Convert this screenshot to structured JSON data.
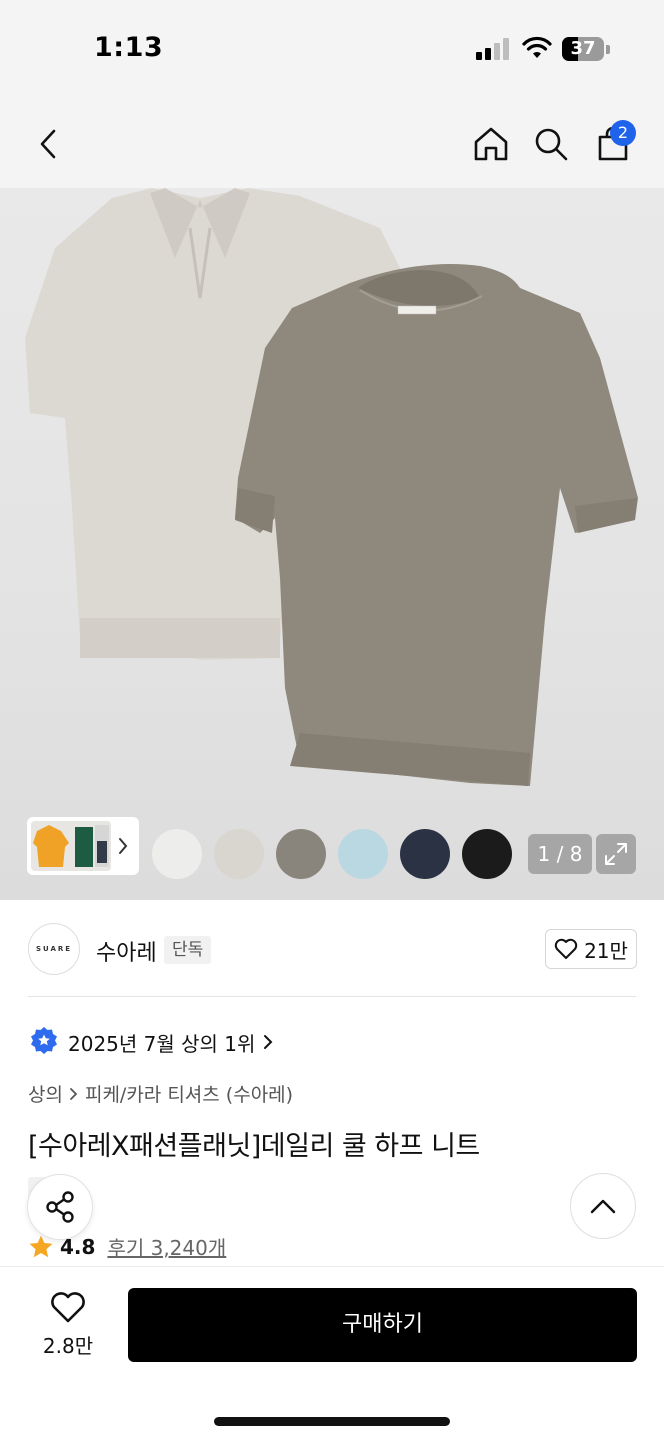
{
  "status_bar": {
    "time": "1:13",
    "battery": "37",
    "battery_level": 0.37
  },
  "nav": {
    "cart_count": "2",
    "icons": [
      "back-icon",
      "home-icon",
      "search-icon",
      "bag-icon"
    ]
  },
  "gallery": {
    "page_indicator": "1 / 8",
    "swatches": [
      "#ededeb",
      "#d9d5cf",
      "#8a857c",
      "#b9d8e2",
      "#2a3244",
      "#1b1b1b"
    ]
  },
  "brand": {
    "logo_text": "SUARE",
    "name": "수아레",
    "badge": "단독",
    "like_count": "21만"
  },
  "ranking": {
    "text": "2025년 7월 상의 1위"
  },
  "breadcrumb": {
    "level1": "상의",
    "level2": "피케/카라 티셔츠 (수아레)"
  },
  "product": {
    "title": "[수아레X패션플래닛]데일리 쿨 하프 니트",
    "tag": "단독",
    "rating": "4.8",
    "reviews": "후기 3,240개"
  },
  "bottom_bar": {
    "wish_count": "2.8만",
    "buy_label": "구매하기"
  },
  "colors": {
    "accent_blue": "#1e63e9",
    "star": "#f5a623",
    "buy_button": "#000000"
  }
}
